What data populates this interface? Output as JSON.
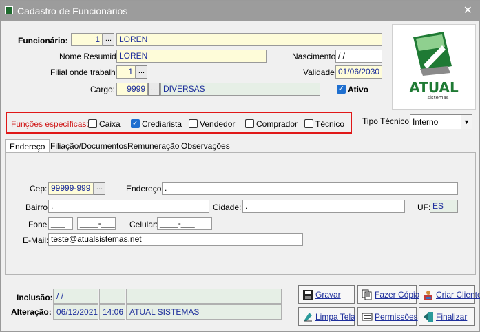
{
  "window": {
    "title": "Cadastro de Funcionários",
    "close": "✕"
  },
  "form": {
    "funcionario_label": "Funcionário:",
    "funcionario_id": "1",
    "funcionario_name": "LOREN",
    "nome_resumido_label": "Nome Resumido:",
    "nome_resumido": "LOREN",
    "nascimento_label": "Nascimento:",
    "nascimento": " /  /",
    "filial_label": "Filial onde trabalha:",
    "filial": "1",
    "validade_label": "Validade:",
    "validade": "01/06/2030",
    "cargo_label": "Cargo:",
    "cargo_id": "9999",
    "cargo_name": "DIVERSAS",
    "ativo_label": "Ativo",
    "ellipsis": "..."
  },
  "logo": {
    "name": "ATUAL",
    "sub": "sistemas"
  },
  "funcoes": {
    "label": "Funções específicas:",
    "items": [
      {
        "label": "Caixa",
        "checked": false
      },
      {
        "label": "Crediarista",
        "checked": true
      },
      {
        "label": "Vendedor",
        "checked": false
      },
      {
        "label": "Comprador",
        "checked": false
      },
      {
        "label": "Técnico",
        "checked": false
      }
    ],
    "tipo_tecnico_label": "Tipo Técnico:",
    "tipo_tecnico": "Interno"
  },
  "tabs": [
    "Endereço",
    "Filiação/Documentos",
    "Remuneração",
    "Observações"
  ],
  "endereco": {
    "cep_label": "Cep:",
    "cep": "99999-999",
    "endereco_label": "Endereço:",
    "endereco": ".",
    "bairro_label": "Bairro:",
    "bairro": ".",
    "cidade_label": "Cidade:",
    "cidade": ".",
    "uf_label": "UF:",
    "uf": "ES",
    "fone_label": "Fone:",
    "fone_ddd": "___",
    "fone_num": "____-___",
    "celular_label": "Celular:",
    "celular": "____-___",
    "email_label": "E-Mail:",
    "email": "teste@atualsistemas.net"
  },
  "footer": {
    "inclusao_label": "Inclusão:",
    "inclusao_date": " /  /",
    "inclusao_time": "",
    "inclusao_user": "",
    "alteracao_label": "Alteração:",
    "alteracao_date": "06/12/2021",
    "alteracao_time": "14:06",
    "alteracao_user": "ATUAL SISTEMAS"
  },
  "buttons": {
    "gravar": "Gravar",
    "fazer_copia": "Fazer Cópia",
    "criar_cliente": "Criar Cliente",
    "limpa_tela": "Limpa Tela",
    "permissoes": "Permissões",
    "finalizar": "Finalizar"
  },
  "colors": {
    "accent_blue": "#1e2f9c",
    "field_yellow": "#fefcd9",
    "highlight_red": "#e01818"
  }
}
